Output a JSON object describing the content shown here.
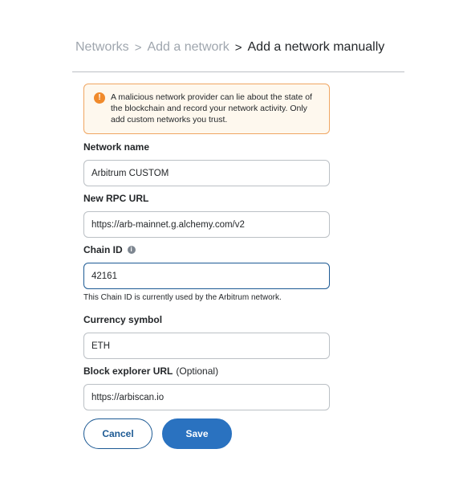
{
  "breadcrumb": {
    "items": [
      "Networks",
      "Add a network",
      "Add a network manually"
    ],
    "separator": ">"
  },
  "warning": {
    "icon": "exclamation-icon",
    "text": "A malicious network provider can lie about the state of the blockchain and record your network activity. Only add custom networks you trust."
  },
  "form": {
    "network_name": {
      "label": "Network name",
      "value": "Arbitrum CUSTOM"
    },
    "rpc_url": {
      "label": "New RPC URL",
      "value": "https://arb-mainnet.g.alchemy.com/v2"
    },
    "chain_id": {
      "label": "Chain ID",
      "value": "42161",
      "info_icon": "i",
      "helper": "This Chain ID is currently used by the Arbitrum network."
    },
    "currency_symbol": {
      "label": "Currency symbol",
      "value": "ETH"
    },
    "block_explorer": {
      "label": "Block explorer URL",
      "optional": "(Optional)",
      "value": "https://arbiscan.io"
    }
  },
  "actions": {
    "cancel": "Cancel",
    "save": "Save"
  },
  "colors": {
    "accent": "#2a72c0",
    "accent_dark": "#1d5a94",
    "warning_border": "#f0a662",
    "warning_bg": "#fef8ee",
    "warning_icon": "#f08a2c"
  }
}
